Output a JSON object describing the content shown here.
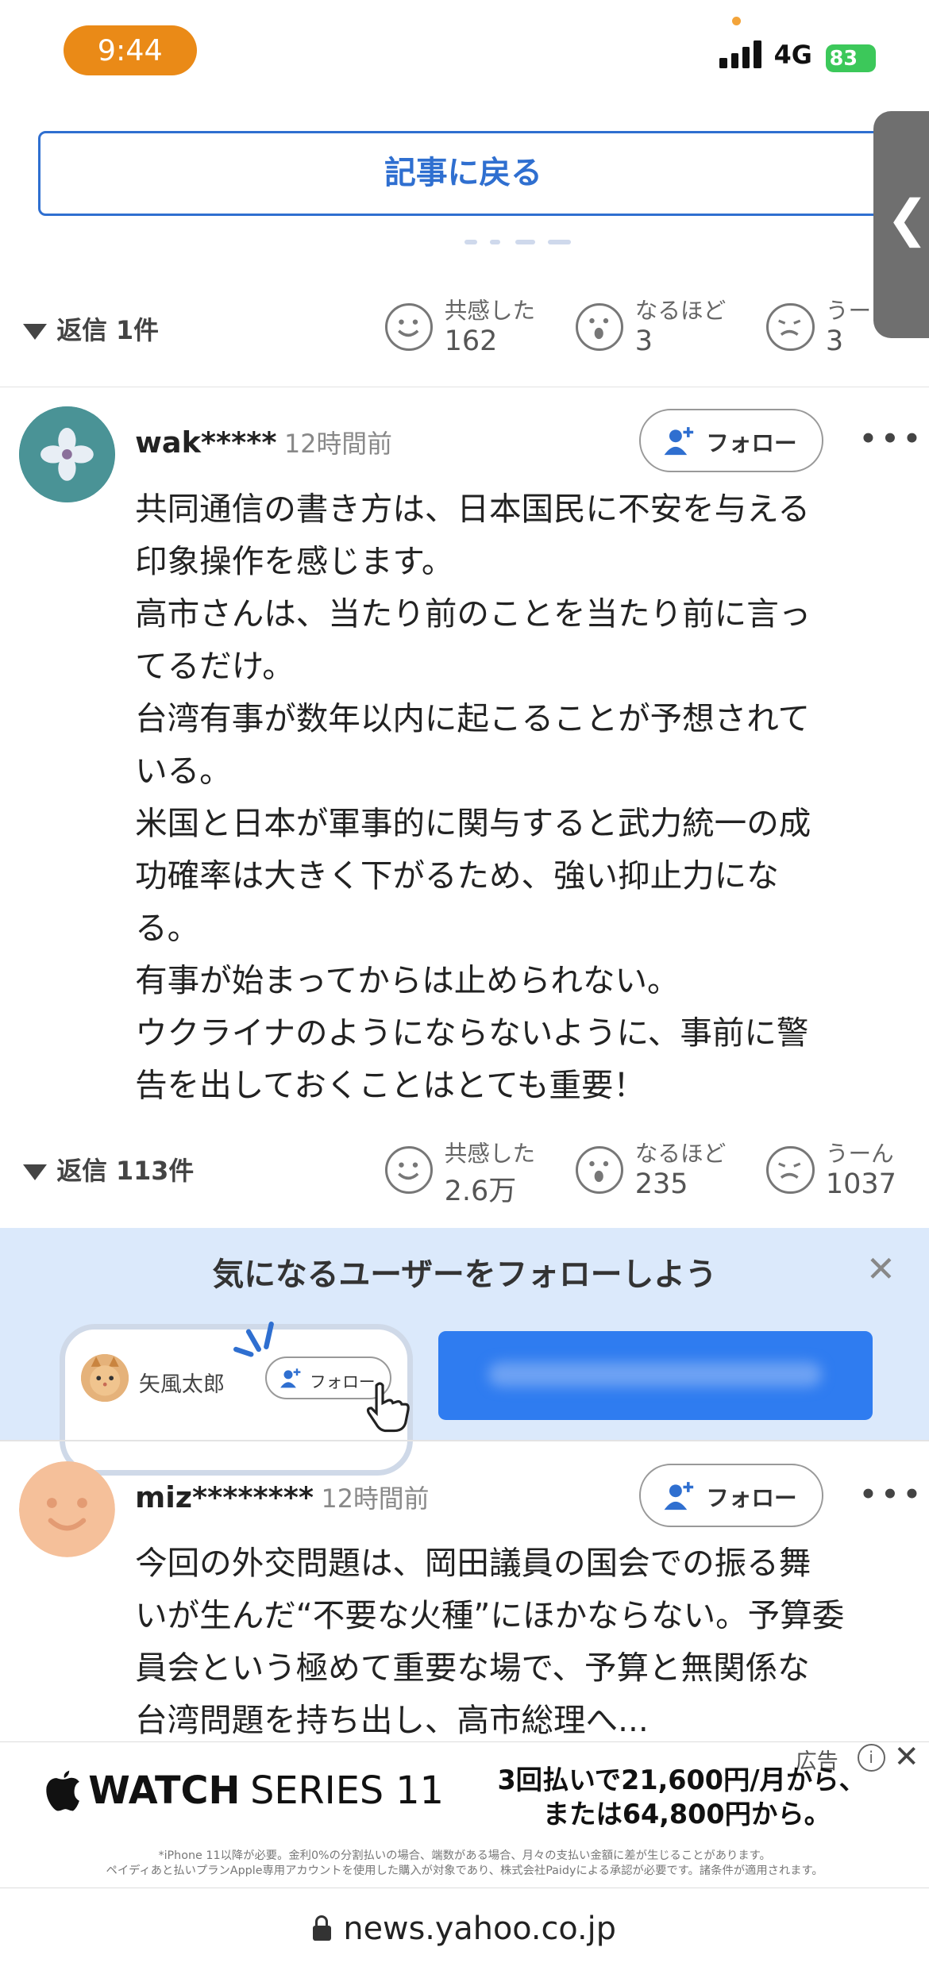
{
  "status_bar": {
    "time": "9:44",
    "network": "4G",
    "battery": "83"
  },
  "back_button": {
    "label": "記事に戻る"
  },
  "reply_bar_1": {
    "replies": "返信 1件",
    "reactions": [
      {
        "label": "共感した",
        "count": "162"
      },
      {
        "label": "なるほど",
        "count": "3"
      },
      {
        "label": "うー",
        "count": "3"
      }
    ]
  },
  "comment_1": {
    "username": "wak*****",
    "time": "12時間前",
    "follow": "フォロー",
    "more": "•••",
    "lines": [
      "共同通信の書き方は、日本国民に不安を与える",
      "印象操作を感じます。",
      "高市さんは、当たり前のことを当たり前に言っ",
      "てるだけ。",
      "台湾有事が数年以内に起こることが予想されて",
      "いる。",
      "米国と日本が軍事的に関与すると武力統一の成",
      "功確率は大きく下がるため、強い抑止力にな",
      "る。",
      "有事が始まってからは止められない。",
      "ウクライナのようにならないように、事前に警",
      "告を出しておくことはとても重要！"
    ],
    "replies": "返信 113件",
    "reactions": [
      {
        "label": "共感した",
        "count": "2.6万"
      },
      {
        "label": "なるほど",
        "count": "235"
      },
      {
        "label": "うーん",
        "count": "1037"
      }
    ]
  },
  "follow_promo": {
    "title": "気になるユーザーをフォローしよう",
    "close": "✕",
    "sample_user": "矢風太郎",
    "sample_follow": "フォロー"
  },
  "comment_2": {
    "username": "miz********",
    "time": "12時間前",
    "follow": "フォロー",
    "more": "•••",
    "lines": [
      "今回の外交問題は、岡田議員の国会での振る舞",
      "いが生んだ“不要な火種”にほかならない。予算委",
      "員会という極めて重要な場で、予算と無関係な",
      "台湾問題を持ち出し、高市総理へ..."
    ]
  },
  "ad": {
    "tag": "広告",
    "info": "i",
    "close": "✕",
    "brand_watch": "WATCH",
    "brand_series": "SERIES 11",
    "price_line1": "3回払いで21,600円/月から、",
    "price_line2": "または64,800円から。",
    "fine1": "*iPhone 11以降が必要。金利0%の分割払いの場合、端数がある場合、月々の支払い金額に差が生じることがあります。",
    "fine2": "ペイディあと払いプランApple専用アカウントを使用した購入が対象であり、株式会社Paidyによる承認が必要です。諸条件が適用されます。"
  },
  "address_bar": {
    "url": "news.yahoo.co.jp"
  },
  "colors": {
    "accent": "#2f6fd0",
    "time_pill": "#ea8a17",
    "battery": "#3cc85a",
    "promo_bg": "#dbe9fb",
    "cta": "#2f7cf0"
  }
}
